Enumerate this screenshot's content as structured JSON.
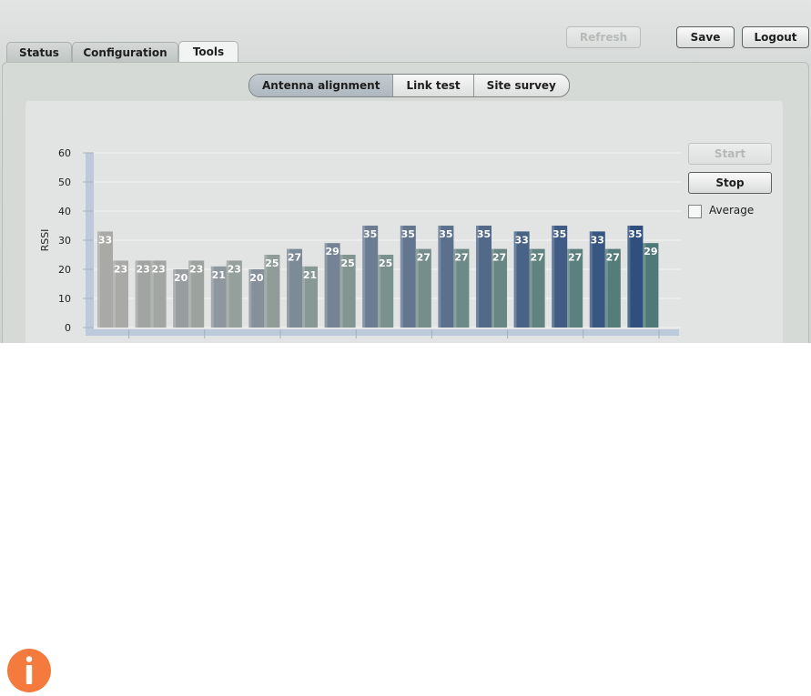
{
  "tabs": [
    {
      "label": "Status",
      "active": false
    },
    {
      "label": "Configuration",
      "active": false
    },
    {
      "label": "Tools",
      "active": true
    }
  ],
  "header_buttons": {
    "refresh": "Refresh",
    "save": "Save",
    "logout": "Logout"
  },
  "subtabs": [
    {
      "label": "Antenna alignment",
      "active": true
    },
    {
      "label": "Link test",
      "active": false
    },
    {
      "label": "Site survey",
      "active": false
    }
  ],
  "controls": {
    "start": "Start",
    "stop": "Stop",
    "average": "Average",
    "average_checked": false
  },
  "icons": {
    "info": "info-icon"
  },
  "colors": {
    "info": "#f47a3d",
    "bar_active": "#2f4f7f",
    "bar_idle": "#a9aaa6"
  },
  "chart_data": {
    "type": "bar",
    "ylabel": "RSSI",
    "ylim": [
      0,
      60
    ],
    "yticks": [
      0,
      10,
      20,
      30,
      40,
      50,
      60
    ],
    "grid": true,
    "pairs": [
      {
        "a": 33,
        "b": 23
      },
      {
        "a": 23,
        "b": 23
      },
      {
        "a": 20,
        "b": 23
      },
      {
        "a": 21,
        "b": 23
      },
      {
        "a": 20,
        "b": 25
      },
      {
        "a": 27,
        "b": 21
      },
      {
        "a": 29,
        "b": 25
      },
      {
        "a": 35,
        "b": 25
      },
      {
        "a": 35,
        "b": 27
      },
      {
        "a": 35,
        "b": 27
      },
      {
        "a": 35,
        "b": 27
      },
      {
        "a": 33,
        "b": 27
      },
      {
        "a": 35,
        "b": 27
      },
      {
        "a": 33,
        "b": 27
      },
      {
        "a": 35,
        "b": 29
      }
    ]
  }
}
